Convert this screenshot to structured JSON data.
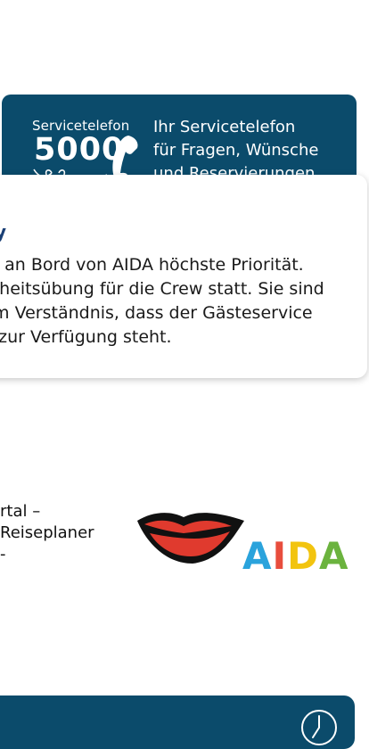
{
  "service": {
    "logo_label": "Servicetelefon",
    "logo_number": "5000",
    "text_lines": [
      "Ihr Servicetelefon",
      "für Fragen, Wünsche",
      "und Reservierungen"
    ],
    "background_color": "#0b4b6b"
  },
  "notice": {
    "title_fragment": "y",
    "body_lines": [
      "at an Bord von AIDA höchste Priorität.",
      "erheitsübung für die Crew statt. Sie sind",
      "um Verständnis, dass der Gästeservice",
      "g zur Verfügung steht."
    ]
  },
  "portal": {
    "lines": [
      "rtal –",
      "Reiseplaner",
      "-"
    ]
  },
  "aida_logo": {
    "letters": [
      {
        "char": "A",
        "color": "#2aa3dc"
      },
      {
        "char": "I",
        "color": "#e84d3d"
      },
      {
        "char": "D",
        "color": "#f2c40f"
      },
      {
        "char": "A",
        "color": "#6bb33e"
      }
    ]
  },
  "bottom_bar": {
    "icon": "clock-icon",
    "color": "#0b4b6b"
  }
}
